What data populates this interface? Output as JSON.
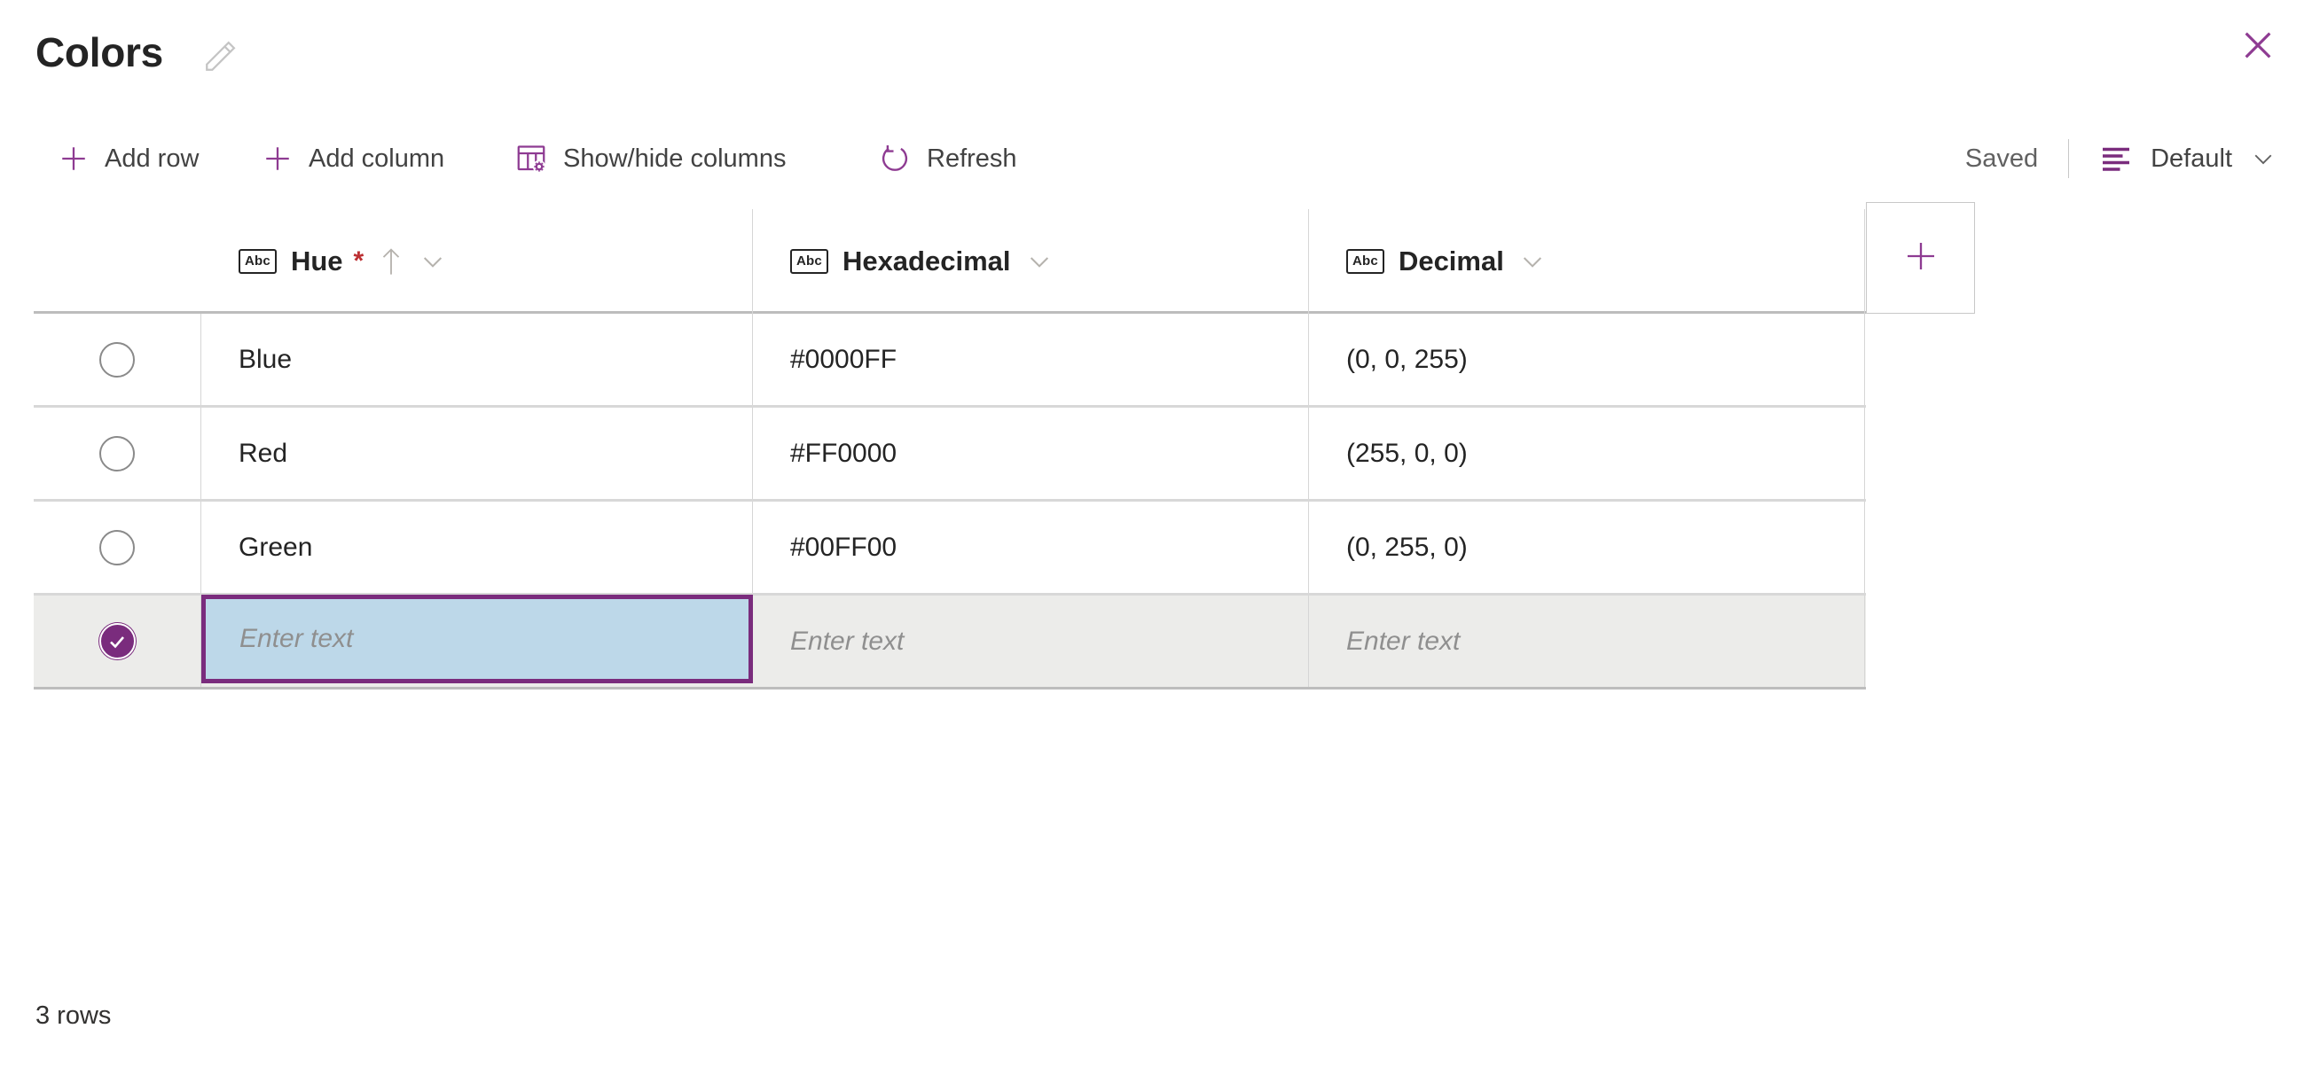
{
  "header": {
    "title": "Colors",
    "edit_icon": "pencil-icon",
    "close_icon": "close-icon"
  },
  "toolbar": {
    "items": [
      {
        "label": "Add row",
        "icon": "plus-icon"
      },
      {
        "label": "Add column",
        "icon": "plus-icon"
      },
      {
        "label": "Show/hide columns",
        "icon": "table-settings-icon"
      },
      {
        "label": "Refresh",
        "icon": "refresh-icon"
      }
    ],
    "status": "Saved",
    "view": {
      "label": "Default",
      "icon": "view-list-icon",
      "chevron": "chevron-down-icon"
    }
  },
  "table": {
    "columns": [
      {
        "name": "Hue",
        "type_badge": "Abc",
        "required": true,
        "required_mark": "*",
        "sorted": "ascending",
        "sort_icon": "arrow-up-icon",
        "menu_icon": "chevron-down-icon"
      },
      {
        "name": "Hexadecimal",
        "type_badge": "Abc",
        "required": false,
        "menu_icon": "chevron-down-icon"
      },
      {
        "name": "Decimal",
        "type_badge": "Abc",
        "required": false,
        "menu_icon": "chevron-down-icon"
      }
    ],
    "add_column_icon": "plus-icon",
    "rows": [
      {
        "selected": false,
        "hue": "Blue",
        "hexadecimal": "#0000FF",
        "decimal": "(0, 0, 255)"
      },
      {
        "selected": false,
        "hue": "Red",
        "hexadecimal": "#FF0000",
        "decimal": "(255, 0, 0)"
      },
      {
        "selected": false,
        "hue": "Green",
        "hexadecimal": "#00FF00",
        "decimal": "(0, 255, 0)"
      }
    ],
    "new_row": {
      "selected": true,
      "hue_placeholder": "Enter text",
      "hexadecimal_placeholder": "Enter text",
      "decimal_placeholder": "Enter text",
      "editing_column": "Hue"
    }
  },
  "footer": {
    "row_count": "3 rows"
  },
  "colors": {
    "accent": "#7a2c7d",
    "required_star": "#bc2f32",
    "selected_cell_fill": "#bdd8e9",
    "active_row_fill": "#ececea",
    "text": "#242424",
    "muted_text": "#8f8f8f"
  }
}
